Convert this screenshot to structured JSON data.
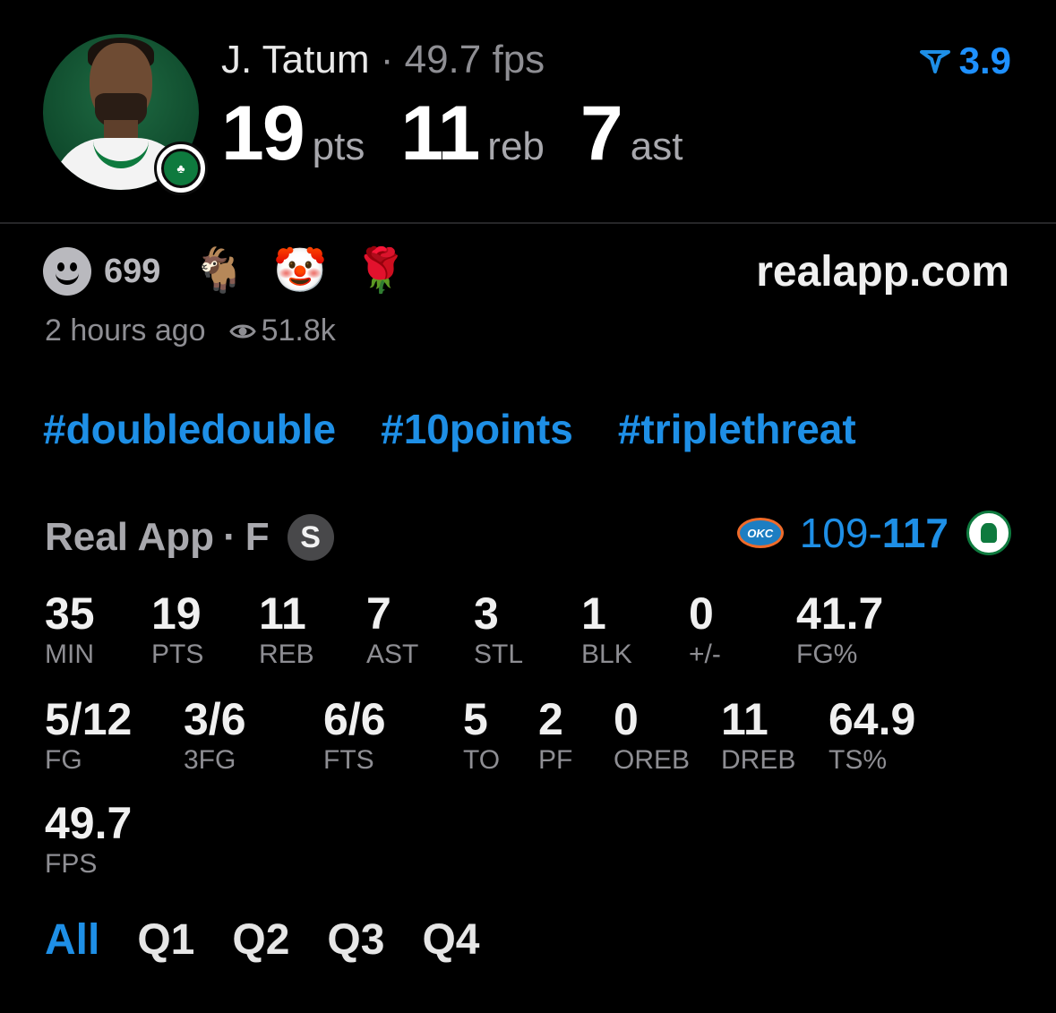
{
  "header": {
    "player_name": "J. Tatum",
    "separator": "·",
    "fps_text": "49.7 fps",
    "rating": "3.9",
    "team_badge_text": "♣",
    "big_stats": [
      {
        "value": "19",
        "unit": "pts"
      },
      {
        "value": "11",
        "unit": "reb"
      },
      {
        "value": "7",
        "unit": "ast"
      }
    ]
  },
  "reactions": {
    "count": "699",
    "emojis": [
      "🐐",
      "🤡",
      "🌹"
    ]
  },
  "site": "realapp.com",
  "meta": {
    "time_ago": "2 hours ago",
    "views": "51.8k"
  },
  "tags": [
    "#doubledouble",
    "#10points",
    "#triplethreat"
  ],
  "game": {
    "source": "Real App",
    "dot": "·",
    "position": "F",
    "badge": "S",
    "away_logo_text": "OKC",
    "away_score": "109",
    "dash": "-",
    "home_score": "117"
  },
  "stats_row1": [
    {
      "value": "35",
      "label": "MIN"
    },
    {
      "value": "19",
      "label": "PTS"
    },
    {
      "value": "11",
      "label": "REB"
    },
    {
      "value": "7",
      "label": "AST"
    },
    {
      "value": "3",
      "label": "STL"
    },
    {
      "value": "1",
      "label": "BLK"
    },
    {
      "value": "0",
      "label": "+/-"
    },
    {
      "value": "41.7",
      "label": "FG%"
    }
  ],
  "stats_row2": [
    {
      "value": "5/12",
      "label": "FG"
    },
    {
      "value": "3/6",
      "label": "3FG"
    },
    {
      "value": "6/6",
      "label": "FTS"
    },
    {
      "value": "5",
      "label": "TO"
    },
    {
      "value": "2",
      "label": "PF"
    },
    {
      "value": "0",
      "label": "OREB"
    },
    {
      "value": "11",
      "label": "DREB"
    },
    {
      "value": "64.9",
      "label": "TS%"
    }
  ],
  "stats_row3": [
    {
      "value": "49.7",
      "label": "FPS"
    }
  ],
  "tabs": [
    "All",
    "Q1",
    "Q2",
    "Q3",
    "Q4"
  ],
  "active_tab": "All",
  "colors": {
    "accent": "#1e8fe6",
    "background": "#000000",
    "muted": "#8e8e93",
    "celtics_green": "#0e7a3e"
  },
  "icons": {
    "rating": "real-rating-icon",
    "views": "eye-icon",
    "reaction": "smiley-icon"
  }
}
